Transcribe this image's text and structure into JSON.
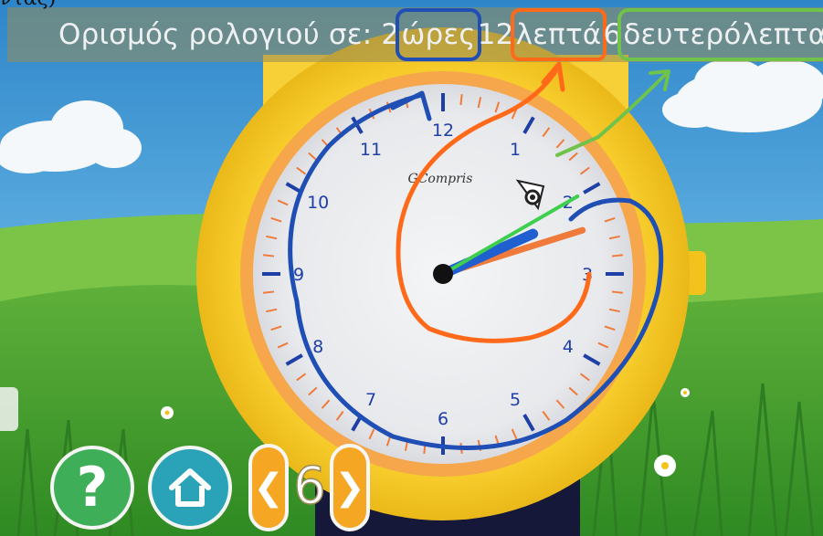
{
  "instruction": {
    "prefix": "Ορισμός ρολογιού σε: 2 ",
    "hours_word": "ώρες",
    "middle1": " 12 ",
    "minutes_word": "λεπτά",
    "middle2": " 6 ",
    "seconds_word": "δευτερόλεπτα"
  },
  "corner_text": "ντας)",
  "clock": {
    "brand": "GCompris",
    "numbers": [
      "12",
      "1",
      "2",
      "3",
      "4",
      "5",
      "6",
      "7",
      "8",
      "9",
      "10",
      "11"
    ],
    "hour_value": 2,
    "minute_value": 12,
    "second_value": 6
  },
  "controls": {
    "help_label": "?",
    "prev_label": "❮",
    "level_number": "6",
    "next_label": "❯"
  },
  "colors": {
    "hour_annotation": "#1f4fb4",
    "minute_annotation": "#ff6a1a",
    "second_annotation": "#6fc24a",
    "hour_hand": "#1f5fd0",
    "minute_hand": "#f07a3a",
    "second_hand": "#3fcf4f",
    "watch_gold": "#f5c51c"
  }
}
